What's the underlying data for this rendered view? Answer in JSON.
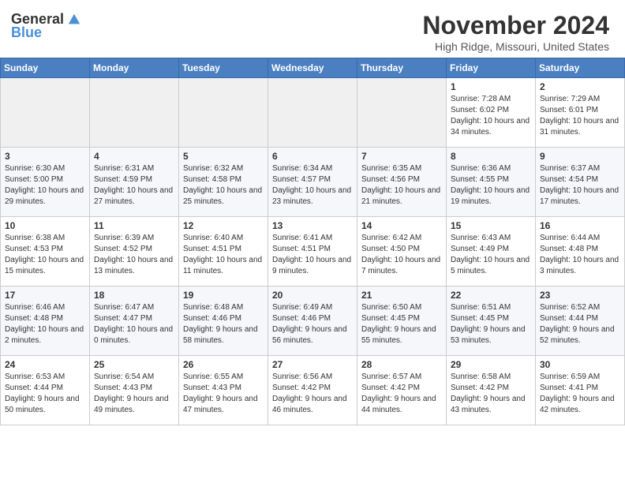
{
  "logo": {
    "general": "General",
    "blue": "Blue"
  },
  "title": "November 2024",
  "location": "High Ridge, Missouri, United States",
  "days_header": [
    "Sunday",
    "Monday",
    "Tuesday",
    "Wednesday",
    "Thursday",
    "Friday",
    "Saturday"
  ],
  "weeks": [
    [
      {
        "day": "",
        "info": ""
      },
      {
        "day": "",
        "info": ""
      },
      {
        "day": "",
        "info": ""
      },
      {
        "day": "",
        "info": ""
      },
      {
        "day": "",
        "info": ""
      },
      {
        "day": "1",
        "info": "Sunrise: 7:28 AM\nSunset: 6:02 PM\nDaylight: 10 hours\nand 34 minutes."
      },
      {
        "day": "2",
        "info": "Sunrise: 7:29 AM\nSunset: 6:01 PM\nDaylight: 10 hours\nand 31 minutes."
      }
    ],
    [
      {
        "day": "3",
        "info": "Sunrise: 6:30 AM\nSunset: 5:00 PM\nDaylight: 10 hours\nand 29 minutes."
      },
      {
        "day": "4",
        "info": "Sunrise: 6:31 AM\nSunset: 4:59 PM\nDaylight: 10 hours\nand 27 minutes."
      },
      {
        "day": "5",
        "info": "Sunrise: 6:32 AM\nSunset: 4:58 PM\nDaylight: 10 hours\nand 25 minutes."
      },
      {
        "day": "6",
        "info": "Sunrise: 6:34 AM\nSunset: 4:57 PM\nDaylight: 10 hours\nand 23 minutes."
      },
      {
        "day": "7",
        "info": "Sunrise: 6:35 AM\nSunset: 4:56 PM\nDaylight: 10 hours\nand 21 minutes."
      },
      {
        "day": "8",
        "info": "Sunrise: 6:36 AM\nSunset: 4:55 PM\nDaylight: 10 hours\nand 19 minutes."
      },
      {
        "day": "9",
        "info": "Sunrise: 6:37 AM\nSunset: 4:54 PM\nDaylight: 10 hours\nand 17 minutes."
      }
    ],
    [
      {
        "day": "10",
        "info": "Sunrise: 6:38 AM\nSunset: 4:53 PM\nDaylight: 10 hours\nand 15 minutes."
      },
      {
        "day": "11",
        "info": "Sunrise: 6:39 AM\nSunset: 4:52 PM\nDaylight: 10 hours\nand 13 minutes."
      },
      {
        "day": "12",
        "info": "Sunrise: 6:40 AM\nSunset: 4:51 PM\nDaylight: 10 hours\nand 11 minutes."
      },
      {
        "day": "13",
        "info": "Sunrise: 6:41 AM\nSunset: 4:51 PM\nDaylight: 10 hours\nand 9 minutes."
      },
      {
        "day": "14",
        "info": "Sunrise: 6:42 AM\nSunset: 4:50 PM\nDaylight: 10 hours\nand 7 minutes."
      },
      {
        "day": "15",
        "info": "Sunrise: 6:43 AM\nSunset: 4:49 PM\nDaylight: 10 hours\nand 5 minutes."
      },
      {
        "day": "16",
        "info": "Sunrise: 6:44 AM\nSunset: 4:48 PM\nDaylight: 10 hours\nand 3 minutes."
      }
    ],
    [
      {
        "day": "17",
        "info": "Sunrise: 6:46 AM\nSunset: 4:48 PM\nDaylight: 10 hours\nand 2 minutes."
      },
      {
        "day": "18",
        "info": "Sunrise: 6:47 AM\nSunset: 4:47 PM\nDaylight: 10 hours\nand 0 minutes."
      },
      {
        "day": "19",
        "info": "Sunrise: 6:48 AM\nSunset: 4:46 PM\nDaylight: 9 hours\nand 58 minutes."
      },
      {
        "day": "20",
        "info": "Sunrise: 6:49 AM\nSunset: 4:46 PM\nDaylight: 9 hours\nand 56 minutes."
      },
      {
        "day": "21",
        "info": "Sunrise: 6:50 AM\nSunset: 4:45 PM\nDaylight: 9 hours\nand 55 minutes."
      },
      {
        "day": "22",
        "info": "Sunrise: 6:51 AM\nSunset: 4:45 PM\nDaylight: 9 hours\nand 53 minutes."
      },
      {
        "day": "23",
        "info": "Sunrise: 6:52 AM\nSunset: 4:44 PM\nDaylight: 9 hours\nand 52 minutes."
      }
    ],
    [
      {
        "day": "24",
        "info": "Sunrise: 6:53 AM\nSunset: 4:44 PM\nDaylight: 9 hours\nand 50 minutes."
      },
      {
        "day": "25",
        "info": "Sunrise: 6:54 AM\nSunset: 4:43 PM\nDaylight: 9 hours\nand 49 minutes."
      },
      {
        "day": "26",
        "info": "Sunrise: 6:55 AM\nSunset: 4:43 PM\nDaylight: 9 hours\nand 47 minutes."
      },
      {
        "day": "27",
        "info": "Sunrise: 6:56 AM\nSunset: 4:42 PM\nDaylight: 9 hours\nand 46 minutes."
      },
      {
        "day": "28",
        "info": "Sunrise: 6:57 AM\nSunset: 4:42 PM\nDaylight: 9 hours\nand 44 minutes."
      },
      {
        "day": "29",
        "info": "Sunrise: 6:58 AM\nSunset: 4:42 PM\nDaylight: 9 hours\nand 43 minutes."
      },
      {
        "day": "30",
        "info": "Sunrise: 6:59 AM\nSunset: 4:41 PM\nDaylight: 9 hours\nand 42 minutes."
      }
    ]
  ]
}
